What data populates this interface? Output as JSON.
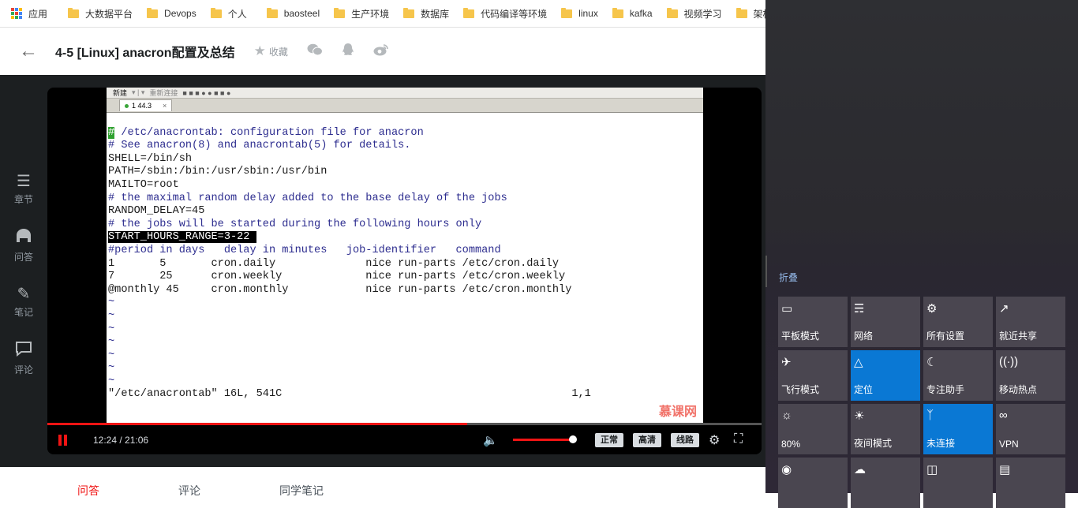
{
  "bookmarks": {
    "apps_label": "应用",
    "items": [
      "大数据平台",
      "Devops",
      "个人",
      "baosteel",
      "生产环境",
      "数据库",
      "代码编译等环境",
      "linux",
      "kafka",
      "视频学习",
      "架构"
    ],
    "accent_folder": "#f6c54b"
  },
  "header": {
    "title": "4-5 [Linux] anacron配置及总结",
    "fav_label": "收藏",
    "icons": [
      "back-arrow-icon",
      "star-icon",
      "wechat-icon",
      "qq-icon",
      "weibo-icon"
    ]
  },
  "sidebar": {
    "items": [
      {
        "label": "章节",
        "icon": "chapters-icon"
      },
      {
        "label": "问答",
        "icon": "qa-icon"
      },
      {
        "label": "笔记",
        "icon": "note-icon"
      },
      {
        "label": "评论",
        "icon": "comment-icon"
      }
    ]
  },
  "terminal": {
    "toolbar_new": "新建",
    "toolbar_reconnect": "重新连接",
    "tab_label": "1 44.3",
    "lines": [
      " /etc/anacrontab: configuration file for anacron",
      "",
      "# See anacron(8) and anacrontab(5) for details.",
      "",
      "SHELL=/bin/sh",
      "PATH=/sbin:/bin:/usr/sbin:/usr/bin",
      "MAILTO=root",
      "# the maximal random delay added to the base delay of the jobs",
      "RANDOM_DELAY=45",
      "# the jobs will be started during the following hours only",
      "START_HOURS_RANGE=3-22 ",
      "",
      "#period in days   delay in minutes   job-identifier   command",
      "1       5       cron.daily              nice run-parts /etc/cron.daily",
      "7       25      cron.weekly             nice run-parts /etc/cron.weekly",
      "@monthly 45     cron.monthly            nice run-parts /etc/cron.monthly",
      "~",
      "~",
      "~",
      "~",
      "~",
      "~",
      "~",
      "\"/etc/anacrontab\" 16L, 541C                                             1,1"
    ],
    "watermark": "慕课网"
  },
  "player": {
    "time": "12:24 / 21:06",
    "progress": 0.588,
    "volume": 0.95,
    "quality_normal": "正常",
    "quality_hd": "高清",
    "route": "线路",
    "accent": "#f01414"
  },
  "bottom_tabs": [
    "问答",
    "评论",
    "同学笔记"
  ],
  "action_center": {
    "collapse_label": "折叠",
    "tiles": [
      {
        "label": "平板模式",
        "icon": "tablet-mode-icon",
        "on": false
      },
      {
        "label": "网络",
        "icon": "network-icon",
        "on": false
      },
      {
        "label": "所有设置",
        "icon": "settings-icon",
        "on": false
      },
      {
        "label": "就近共享",
        "icon": "nearby-share-icon",
        "on": false
      },
      {
        "label": "飞行模式",
        "icon": "airplane-icon",
        "on": false
      },
      {
        "label": "定位",
        "icon": "location-icon",
        "on": true
      },
      {
        "label": "专注助手",
        "icon": "moon-icon",
        "on": false
      },
      {
        "label": "移动热点",
        "icon": "hotspot-icon",
        "on": false
      },
      {
        "label": "80%",
        "icon": "brightness-icon",
        "on": false
      },
      {
        "label": "夜间模式",
        "icon": "night-light-icon",
        "on": false
      },
      {
        "label": "未连接",
        "icon": "bluetooth-icon",
        "on": true
      },
      {
        "label": "VPN",
        "icon": "vpn-icon",
        "on": false
      },
      {
        "label": "",
        "icon": "battery-saver-icon",
        "on": false
      },
      {
        "label": "",
        "icon": "screen-snip-icon",
        "on": false
      },
      {
        "label": "",
        "icon": "project-icon",
        "on": false
      },
      {
        "label": "",
        "icon": "connect-icon",
        "on": false
      }
    ],
    "accent_on": "#0a78d4"
  }
}
